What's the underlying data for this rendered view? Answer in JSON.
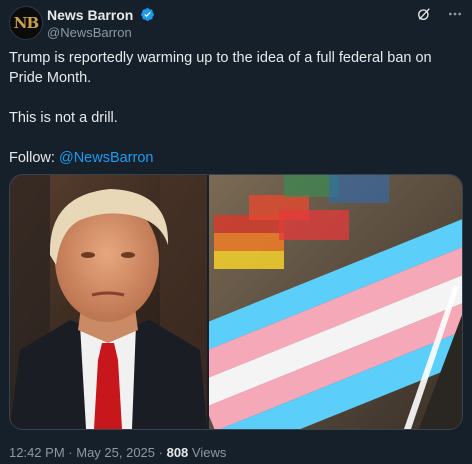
{
  "tweet": {
    "author": {
      "avatar_text": "NB",
      "display_name": "News Barron",
      "handle": "@NewsBarron",
      "verified": true,
      "badge_color": "#1d9bf0"
    },
    "text_line1": "Trump is reportedly warming up to the idea of a full federal ban on Pride Month.",
    "text_line2": "This is not a drill.",
    "follow_label": "Follow:",
    "follow_mention": "@NewsBarron",
    "media": [
      {
        "alt": "portrait-photo"
      },
      {
        "alt": "transgender-pride-flag-photo"
      }
    ],
    "time": "12:42 PM",
    "date": "May 25, 2025",
    "views_count": "808",
    "views_label": "Views"
  },
  "colors": {
    "background": "#15202b",
    "text": "#e7e9ea",
    "muted": "#8b98a5",
    "link": "#1d9bf0",
    "border": "#38444d"
  },
  "icons": [
    "verified-badge-icon",
    "grok-icon",
    "more-options-icon"
  ]
}
